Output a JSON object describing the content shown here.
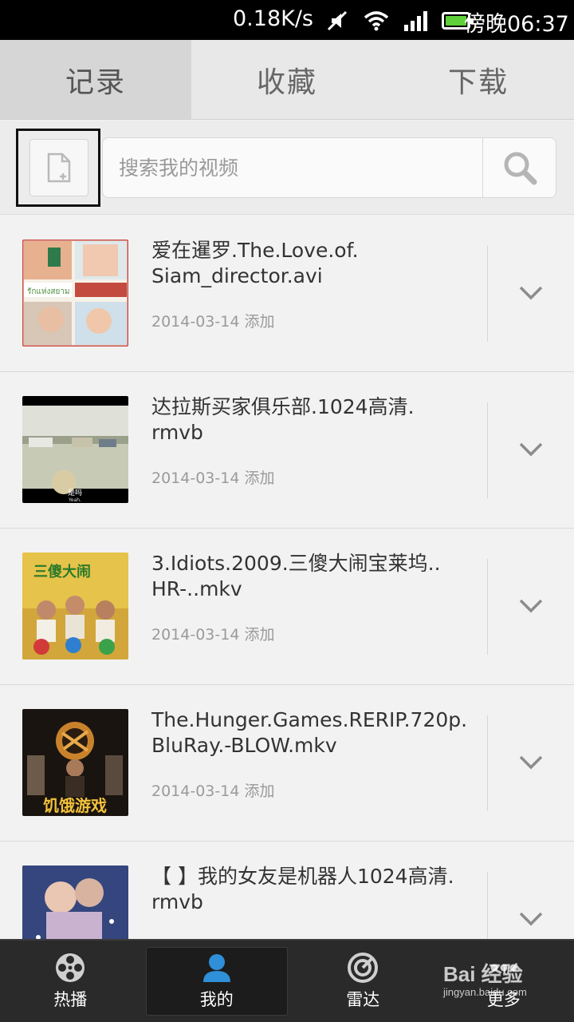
{
  "status_bar": {
    "speed": "0.18K/s",
    "time": "傍晚06:37",
    "icons": [
      "mute-icon",
      "wifi-icon",
      "signal-icon",
      "battery-icon"
    ],
    "battery_color": "#5fd03a"
  },
  "tabs": [
    {
      "label": "记录",
      "active": true
    },
    {
      "label": "收藏",
      "active": false
    },
    {
      "label": "下载",
      "active": false
    }
  ],
  "search": {
    "placeholder": "搜索我的视频"
  },
  "items": [
    {
      "title": "爱在暹罗.The.Love.of.\nSiam_director.avi",
      "date": "2014-03-14 添加"
    },
    {
      "title": "达拉斯买家俱乐部.1024高清.\nrmvb",
      "date": "2014-03-14 添加"
    },
    {
      "title": "3.Idiots.2009.三傻大闹宝莱坞..\nHR-..mkv",
      "date": "2014-03-14 添加"
    },
    {
      "title": "The.Hunger.Games.RERIP.720p.\nBluRay.-BLOW.mkv",
      "date": "2014-03-14 添加"
    },
    {
      "title": "【 】我的女友是机器人1024高清.\nrmvb",
      "date": ""
    }
  ],
  "thumb_texts": {
    "item1_caption": "รักแห่งสยาม",
    "item2_subtitle": "是吗",
    "item2_subtitle_en": "Yeah.",
    "item3_poster": "三傻大闹",
    "item4_poster": "饥饿游戏"
  },
  "bottom_nav": [
    {
      "label": "热播",
      "icon": "film-reel-icon",
      "active": false
    },
    {
      "label": "我的",
      "icon": "user-icon",
      "active": true
    },
    {
      "label": "雷达",
      "icon": "radar-icon",
      "active": false
    },
    {
      "label": "更多",
      "icon": "more-icon",
      "active": false
    }
  ],
  "watermark": {
    "main": "Bai 经验",
    "sub": "jingyan.baidu.com"
  },
  "colors": {
    "tab_active_bg": "#d6d6d6",
    "nav_bg": "#2a2a2a",
    "accent_blue": "#2f8fd8"
  }
}
